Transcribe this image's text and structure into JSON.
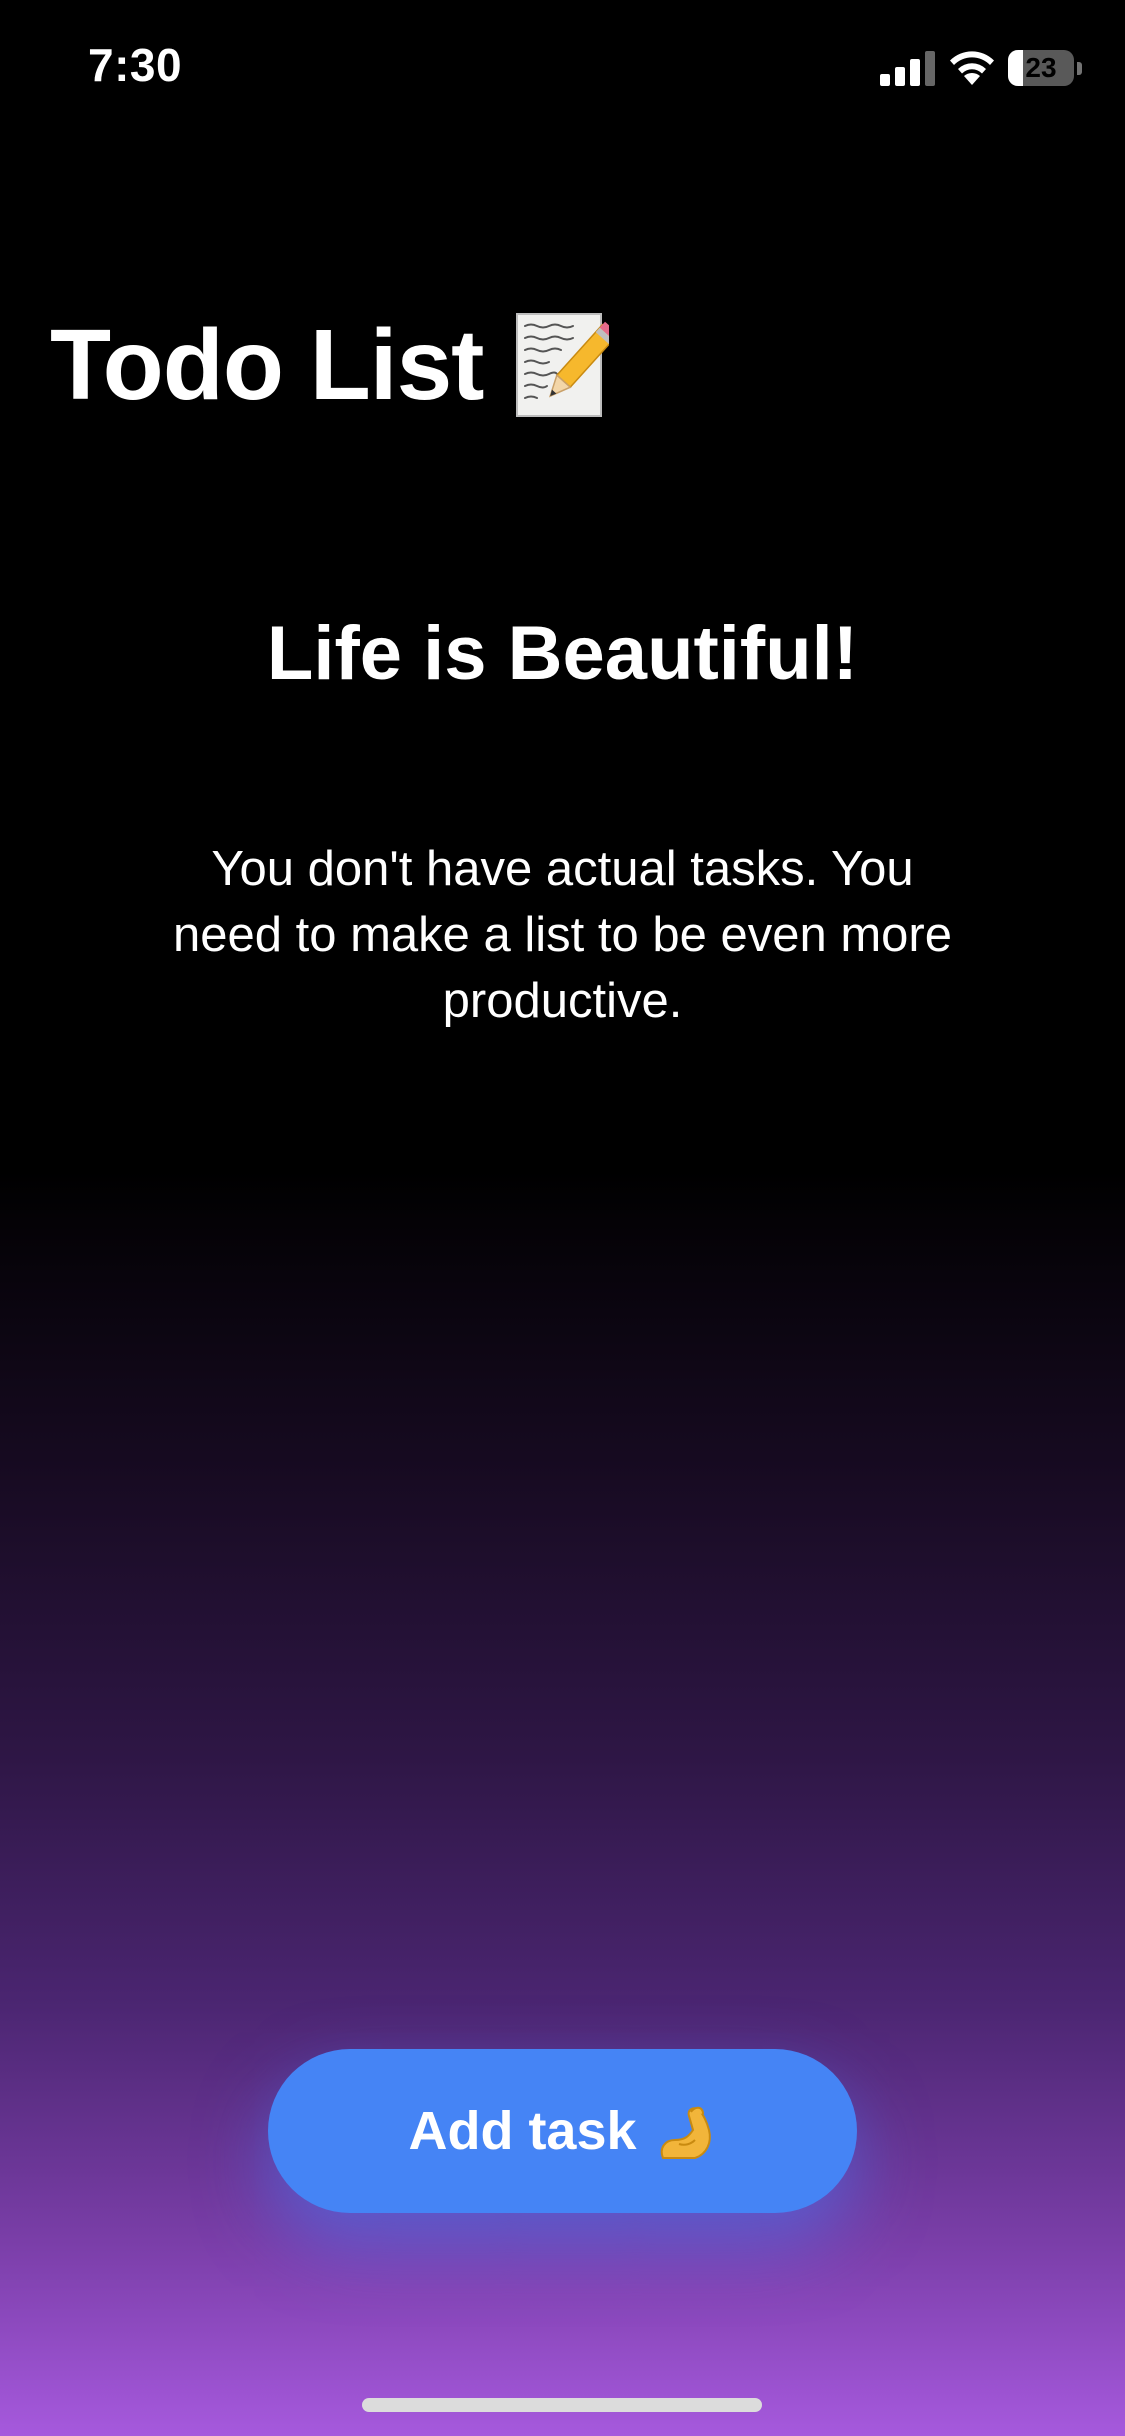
{
  "status_bar": {
    "time": "7:30",
    "battery_level": "23",
    "battery_fraction": 0.23,
    "icons": [
      "signal-icon",
      "wifi-icon",
      "battery-icon"
    ]
  },
  "header": {
    "title": "Todo List",
    "title_icon": "memo-icon"
  },
  "empty_state": {
    "title": "Life is Beautiful!",
    "message": "You don't have actual tasks. You need to make a list to be even more productive."
  },
  "add_task_button": {
    "label": "Add task",
    "icon": "flexed-biceps-icon"
  },
  "colors": {
    "background_top": "#000000",
    "background_bottom": "#a659dd",
    "button": "#4584f5",
    "text": "#ffffff"
  }
}
